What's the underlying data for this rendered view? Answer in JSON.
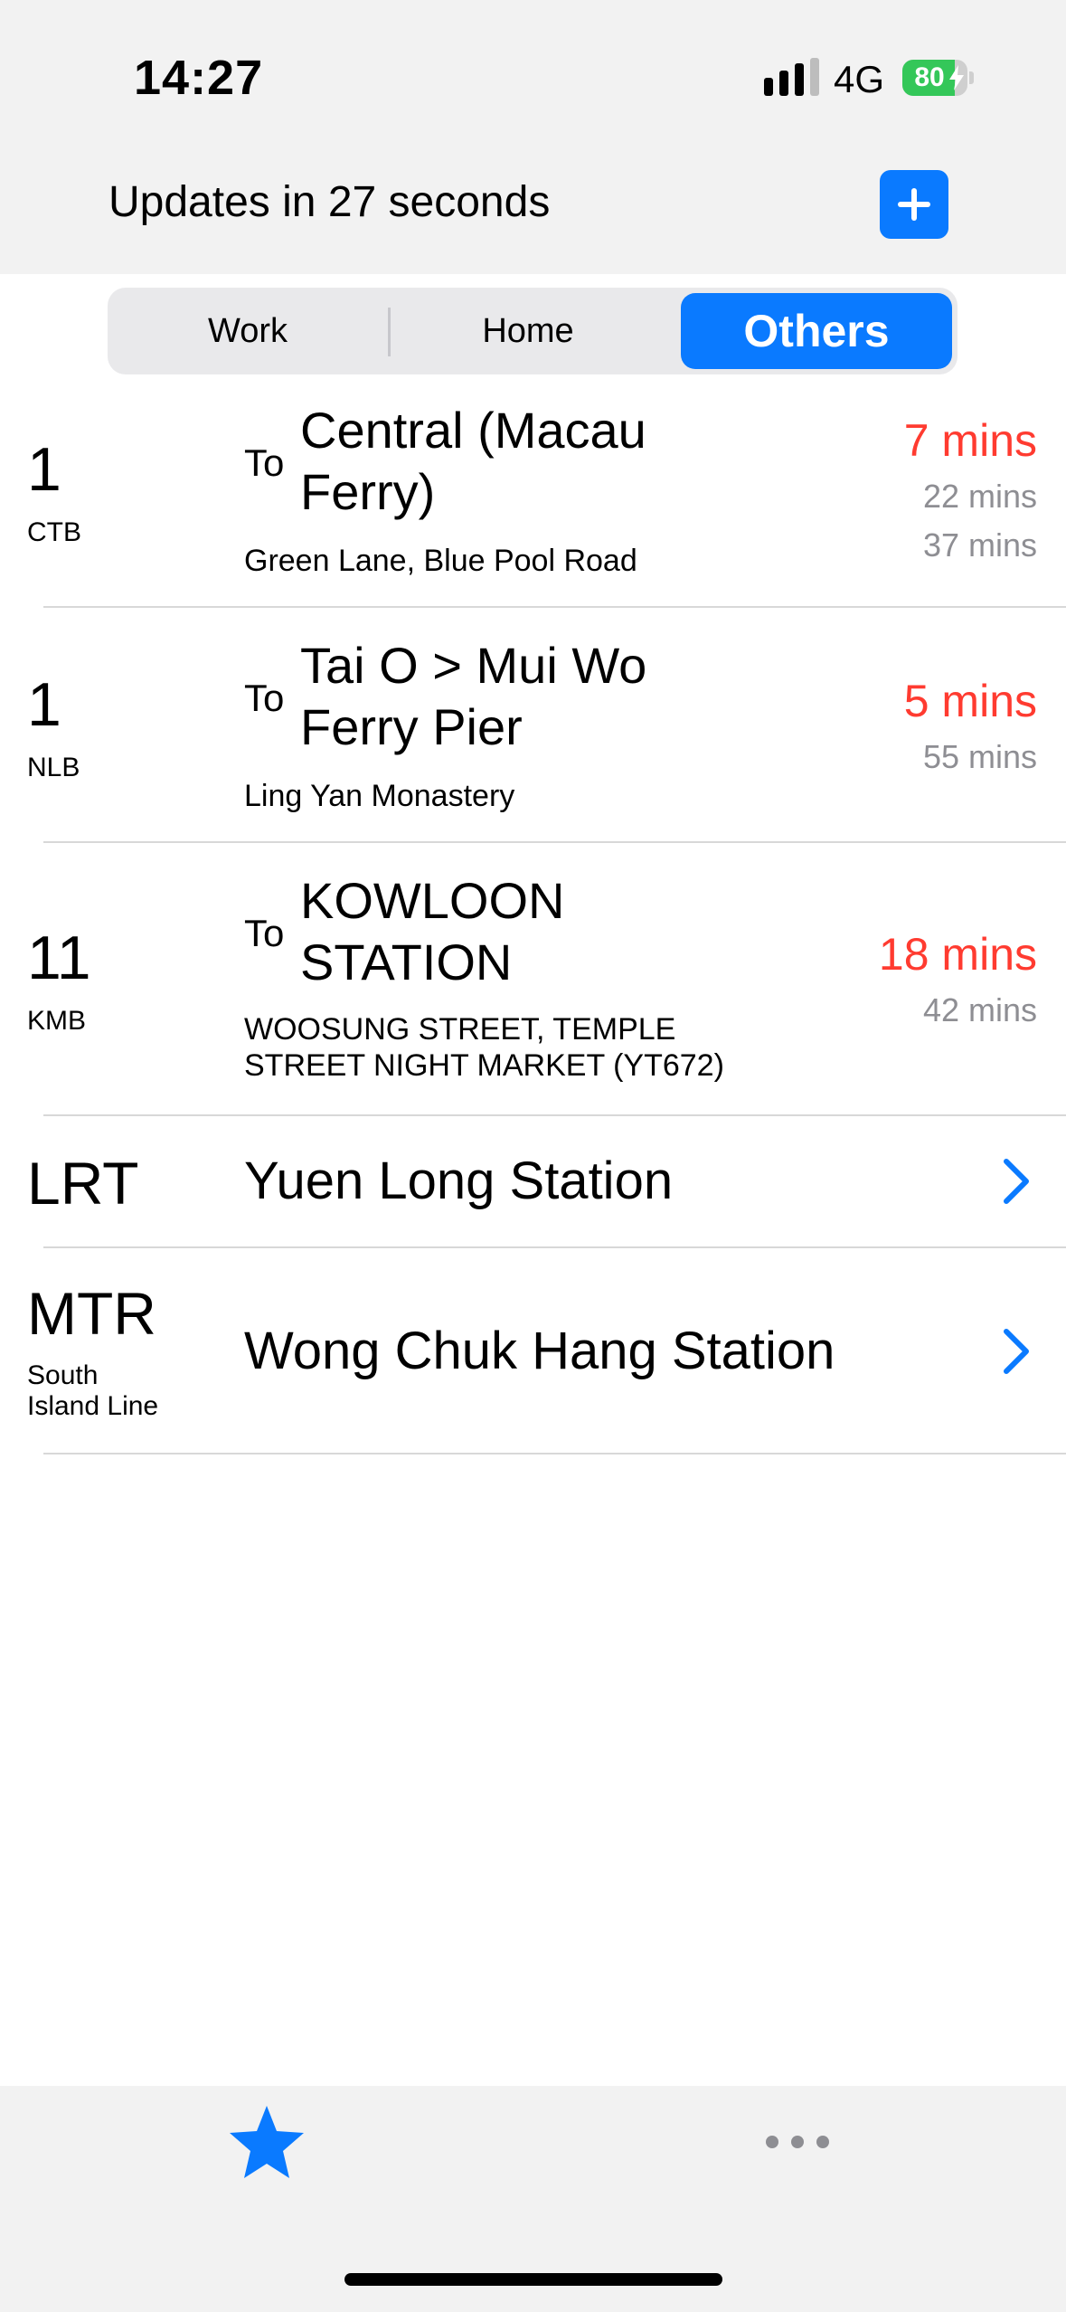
{
  "status_bar": {
    "time": "14:27",
    "network": "4G",
    "battery_percent": 80,
    "battery_label": "80"
  },
  "header": {
    "updates_text": "Updates in 27 seconds",
    "add_icon": "plus-icon"
  },
  "tabs": [
    {
      "label": "Work",
      "selected": false
    },
    {
      "label": "Home",
      "selected": false
    },
    {
      "label": "Others",
      "selected": true
    }
  ],
  "routes": [
    {
      "number": "1",
      "operator": "CTB",
      "to_label": "To",
      "destination_line1": "Central (Macau",
      "destination_line2": "Ferry)",
      "stop": "Green Lane, Blue Pool Road",
      "eta_next": "7 mins",
      "eta_later": [
        "22 mins",
        "37 mins"
      ]
    },
    {
      "number": "1",
      "operator": "NLB",
      "to_label": "To",
      "destination_line1": "Tai O > Mui Wo",
      "destination_line2": "Ferry Pier",
      "stop": "Ling Yan Monastery",
      "eta_next": "5 mins",
      "eta_later": [
        "55 mins"
      ]
    },
    {
      "number": "11",
      "operator": "KMB",
      "to_label": "To",
      "destination_line1": "KOWLOON",
      "destination_line2": "STATION",
      "stop_line1": "WOOSUNG STREET, TEMPLE",
      "stop_line2": "STREET NIGHT MARKET (YT672)",
      "eta_next": "18 mins",
      "eta_later": [
        "42 mins"
      ]
    }
  ],
  "rail": [
    {
      "code": "LRT",
      "station": "Yuen Long Station"
    },
    {
      "code": "MTR",
      "line_line1": "South",
      "line_line2": "Island Line",
      "station": "Wong Chuk Hang Station"
    }
  ],
  "tab_bar": {
    "items": [
      {
        "icon": "star-icon",
        "selected": true
      },
      {
        "icon": "ellipsis-icon",
        "selected": false
      }
    ]
  },
  "colors": {
    "accent": "#0a7aff",
    "eta_red": "#ff3b30",
    "secondary_gray": "#8e8e93",
    "battery_green": "#34c759"
  }
}
